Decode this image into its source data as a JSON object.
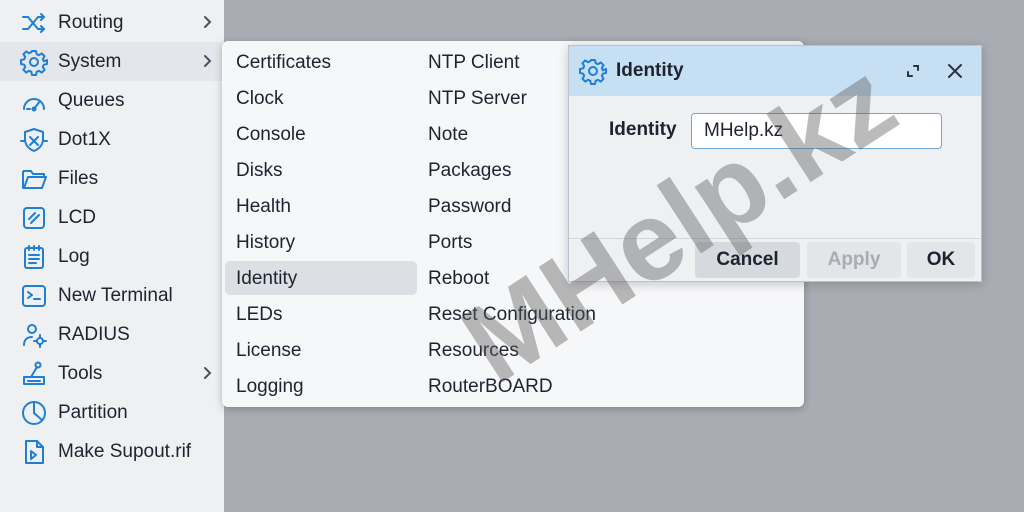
{
  "sidebar": {
    "items": [
      {
        "label": "Routing",
        "icon": "routing-icon",
        "has_submenu": true
      },
      {
        "label": "System",
        "icon": "gear-icon",
        "has_submenu": true,
        "active": true
      },
      {
        "label": "Queues",
        "icon": "gauge-icon",
        "has_submenu": false
      },
      {
        "label": "Dot1X",
        "icon": "dot1x-shield-icon",
        "has_submenu": false
      },
      {
        "label": "Files",
        "icon": "folder-icon",
        "has_submenu": false
      },
      {
        "label": "LCD",
        "icon": "lcd-icon",
        "has_submenu": false
      },
      {
        "label": "Log",
        "icon": "log-icon",
        "has_submenu": false
      },
      {
        "label": "New Terminal",
        "icon": "terminal-icon",
        "has_submenu": false
      },
      {
        "label": "RADIUS",
        "icon": "radius-icon",
        "has_submenu": false
      },
      {
        "label": "Tools",
        "icon": "tools-icon",
        "has_submenu": true
      },
      {
        "label": "Partition",
        "icon": "partition-icon",
        "has_submenu": false
      },
      {
        "label": "Make Supout.rif",
        "icon": "supout-file-icon",
        "has_submenu": false
      }
    ]
  },
  "system_menu": {
    "column_1": [
      "Certificates",
      "Clock",
      "Console",
      "Disks",
      "Health",
      "History",
      "Identity",
      "LEDs",
      "License",
      "Logging"
    ],
    "column_2": [
      "NTP Client",
      "NTP Server",
      "Note",
      "Packages",
      "Password",
      "Ports",
      "Reboot",
      "Reset Configuration",
      "Resources",
      "RouterBOARD"
    ],
    "selected": "Identity"
  },
  "dialog": {
    "title": "Identity",
    "field_label": "Identity",
    "field_value": "MHelp.kz",
    "buttons": {
      "cancel": "Cancel",
      "apply": "Apply",
      "ok": "OK"
    },
    "apply_disabled": true
  },
  "watermark": "MHelp.kz",
  "colors": {
    "accent_blue": "#1f7fd4",
    "header_blue": "#c7dff3",
    "sidebar_bg": "#eef0f2",
    "desktop_bg": "#a9adb3"
  }
}
